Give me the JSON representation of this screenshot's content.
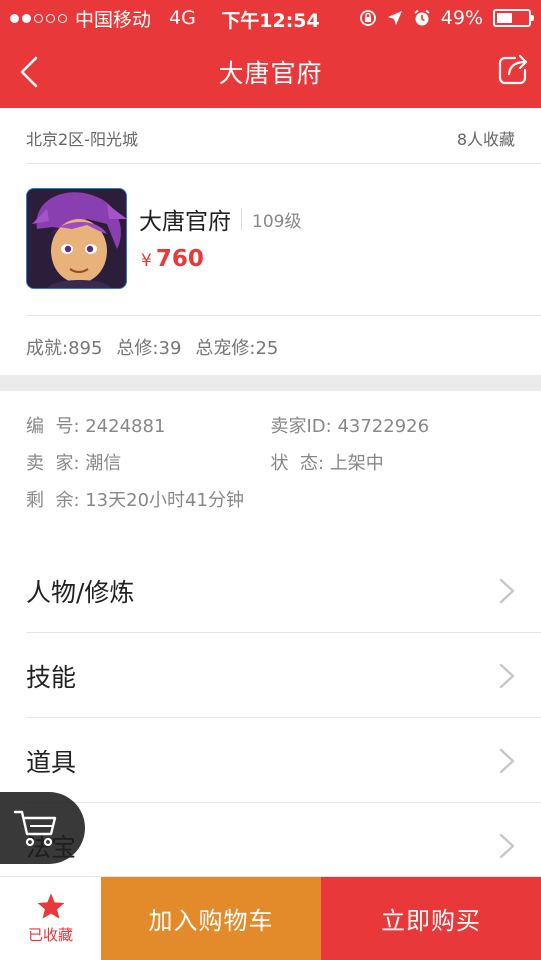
{
  "status_bar": {
    "carrier": "中国移动",
    "network": "4G",
    "time": "下午12:54",
    "battery": "49%",
    "battery_level": 0.49
  },
  "nav": {
    "title": "大唐官府",
    "back_icon": "chevron-left-icon",
    "share_icon": "share-icon"
  },
  "listing": {
    "server": "北京2区-阳光城",
    "favorites": "8人收藏",
    "role_name": "大唐官府",
    "level": "109级",
    "currency": "¥",
    "price": "760",
    "stats": [
      "成就:895",
      "总修:39",
      "总宠修:25"
    ]
  },
  "details": {
    "number": "编  号: 2424881",
    "seller_id": "卖家ID: 43722926",
    "seller": "卖  家: 潮信",
    "status": "状  态: 上架中",
    "remaining": "剩  余: 13天20小时41分钟"
  },
  "menu": [
    {
      "label": "人物/修炼"
    },
    {
      "label": "技能"
    },
    {
      "label": "道具"
    },
    {
      "label": "法宝"
    }
  ],
  "bottom_bar": {
    "favorited_label": "已收藏",
    "add_cart_label": "加入购物车",
    "buy_now_label": "立即购买"
  },
  "colors": {
    "brand_red": "#e8383a",
    "cart_orange": "#e38b2b"
  }
}
